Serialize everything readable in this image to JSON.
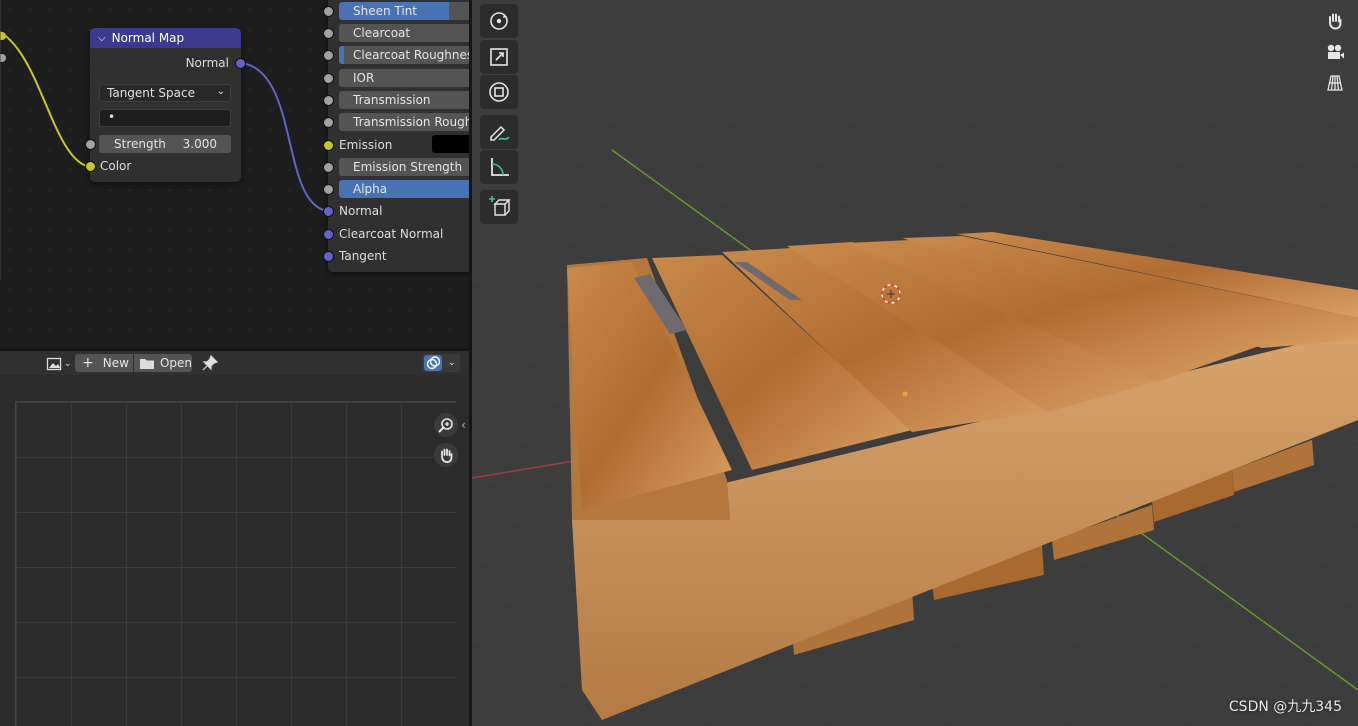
{
  "node_editor": {
    "normal_map_node": {
      "title": "Normal Map",
      "output_normal": "Normal",
      "space_select": "Tangent Space",
      "uv_map_value": "•",
      "strength_label": "Strength",
      "strength_value": "3.000",
      "input_color": "Color"
    },
    "bsdf_inputs": [
      {
        "label": "Sheen Tint",
        "style": "accent"
      },
      {
        "label": "Clearcoat",
        "style": "plain"
      },
      {
        "label": "Clearcoat Roughness",
        "style": "partial"
      },
      {
        "label": "IOR",
        "style": "plain"
      },
      {
        "label": "Transmission",
        "style": "plain"
      },
      {
        "label": "Transmission Roughness",
        "style": "plain"
      },
      {
        "label": "Emission",
        "style": "color"
      },
      {
        "label": "Emission Strength",
        "style": "plain"
      },
      {
        "label": "Alpha",
        "style": "accent"
      },
      {
        "label": "Normal",
        "style": "socket"
      },
      {
        "label": "Clearcoat Normal",
        "style": "socket"
      },
      {
        "label": "Tangent",
        "style": "socket"
      }
    ],
    "colors": {
      "node_header": "#3b3a8e",
      "socket_grey": "#a1a1a1",
      "socket_yellow": "#c7c729",
      "socket_blue": "#6363c7",
      "accent": "#4772b3"
    }
  },
  "image_editor": {
    "header": {
      "editor_type_icon": "image-icon",
      "new_label": "New",
      "open_label": "Open",
      "pin_icon": "pin-icon",
      "overlay_icon": "overlay-icon"
    },
    "tools": [
      "zoom-icon",
      "hand-icon"
    ]
  },
  "viewport": {
    "toolbar_icons": [
      "rotate-icon",
      "scale-icon",
      "transform-icon",
      "annotate-icon",
      "measure-icon",
      "add-cube-icon"
    ],
    "navigation_icons": [
      "hand-icon",
      "camera-icon",
      "grid-view-icon"
    ],
    "watermark": "CSDN @九九345"
  }
}
